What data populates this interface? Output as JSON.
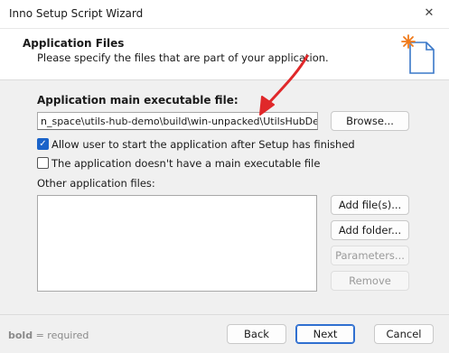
{
  "window": {
    "title": "Inno Setup Script Wizard",
    "close_glyph": "✕"
  },
  "header": {
    "title": "Application Files",
    "subtitle": "Please specify the files that are part of your application.",
    "icon": "document-sparkle-icon"
  },
  "main_exe": {
    "label": "Application main executable file:",
    "value": "n_space\\utils-hub-demo\\build\\win-unpacked\\UtilsHubDemo.exe",
    "browse_label": "Browse..."
  },
  "options": {
    "allow_start": {
      "label": "Allow user to start the application after Setup has finished",
      "checked": true
    },
    "no_main_exe": {
      "label": "The application doesn't have a main executable file",
      "checked": false
    }
  },
  "other_files": {
    "label": "Other application files:",
    "items": [],
    "add_files_label": "Add file(s)...",
    "add_folder_label": "Add folder...",
    "parameters_label": "Parameters...",
    "remove_label": "Remove"
  },
  "footer": {
    "bold_word": "bold",
    "required_text": " = required",
    "back_label": "Back",
    "next_label": "Next",
    "cancel_label": "Cancel"
  },
  "colors": {
    "accent": "#1a63c9",
    "annotation_arrow": "#e0282a",
    "sparkle": "#f07a1a"
  }
}
